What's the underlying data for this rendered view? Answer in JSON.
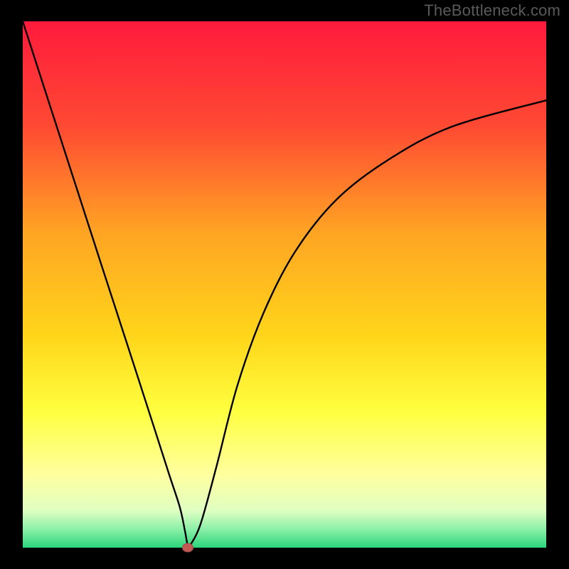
{
  "watermark": "TheBottleneck.com",
  "chart_data": {
    "type": "line",
    "title": "",
    "xlabel": "",
    "ylabel": "",
    "xlim": [
      0,
      100
    ],
    "ylim": [
      0,
      100
    ],
    "background_gradient_stops": [
      {
        "offset": 0.0,
        "color": "#ff1a3c"
      },
      {
        "offset": 0.2,
        "color": "#ff4a33"
      },
      {
        "offset": 0.4,
        "color": "#ffa423"
      },
      {
        "offset": 0.6,
        "color": "#ffd61a"
      },
      {
        "offset": 0.74,
        "color": "#ffff3f"
      },
      {
        "offset": 0.86,
        "color": "#ffff9e"
      },
      {
        "offset": 0.93,
        "color": "#dfffc2"
      },
      {
        "offset": 0.965,
        "color": "#8bf0a8"
      },
      {
        "offset": 1.0,
        "color": "#2bd67a"
      }
    ],
    "series": [
      {
        "name": "bottleneck-curve",
        "x": [
          0,
          5,
          10,
          15,
          20,
          25,
          28,
          30,
          31,
          31.5,
          32,
          34,
          37,
          41,
          46,
          52,
          60,
          70,
          82,
          100
        ],
        "y": [
          100,
          84.6,
          69.2,
          53.8,
          38.5,
          23.1,
          13.8,
          7.7,
          3.1,
          0.5,
          0.5,
          4.6,
          15.4,
          30.8,
          44.6,
          56.2,
          66.2,
          73.8,
          80.0,
          85.0
        ]
      }
    ],
    "marker": {
      "x": 31.5,
      "y": 0,
      "color": "#c15a54"
    }
  }
}
